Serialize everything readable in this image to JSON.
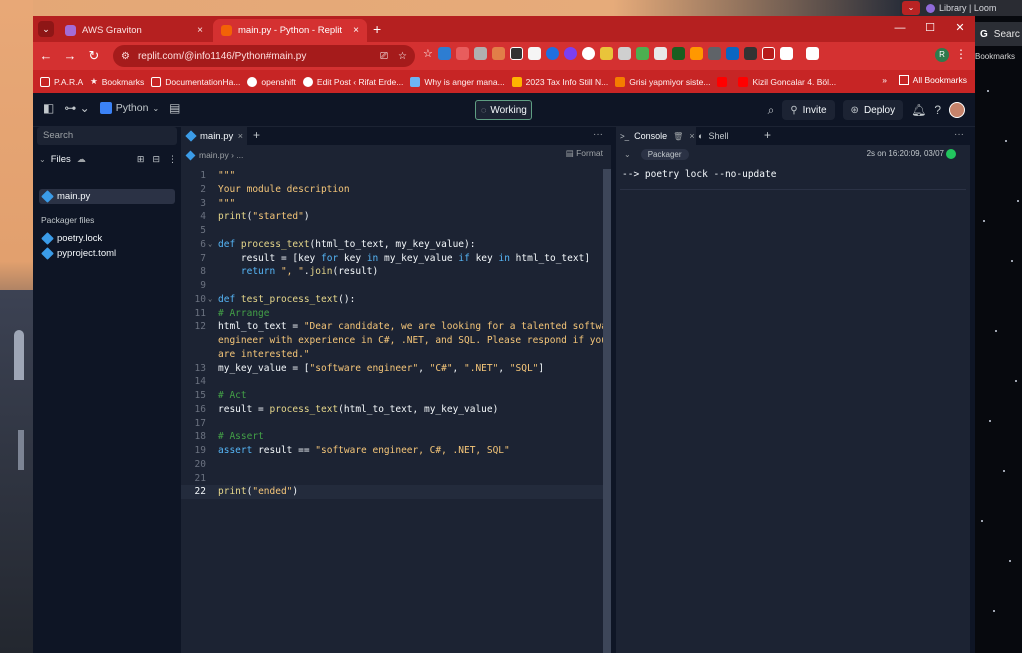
{
  "desktop": {
    "loom_tab_title": "Library | Loom",
    "peek_search": "Searc",
    "peek_bookmarks": "Bookmarks"
  },
  "browser": {
    "tabs": [
      {
        "title": "AWS Graviton",
        "close": "×"
      },
      {
        "title": "main.py - Python - Replit",
        "close": "×"
      }
    ],
    "new_tab": "+",
    "window_controls": {
      "minimize": "—",
      "maximize": "☐",
      "close": "✕"
    },
    "url": "replit.com/@info1146/Python#main.py",
    "bookmarks": [
      "P.A.R.A",
      "Bookmarks",
      "DocumentationHa...",
      "openshift",
      "Edit Post ‹ Rifat Erde...",
      "Why is anger mana...",
      "2023 Tax Info Still N...",
      "Grisi yapmiyor siste...",
      "",
      "Kizil Goncalar 4. Böl..."
    ],
    "bookmarks_more": "»",
    "all_bookmarks": "All Bookmarks",
    "profile_initial": "R"
  },
  "header": {
    "language": "Python",
    "status": "Working",
    "invite": "Invite",
    "deploy": "Deploy",
    "help": "?"
  },
  "sidebar": {
    "search_placeholder": "Search",
    "files_label": "Files",
    "files": [
      "main.py"
    ],
    "packager_label": "Packager files",
    "packager_files": [
      "poetry.lock",
      "pyproject.toml"
    ]
  },
  "editor": {
    "tab": "main.py",
    "breadcrumb": "main.py  ›  ...",
    "format": "Format",
    "lines": [
      {
        "n": "1",
        "t": "\"\"\"",
        "c": "str"
      },
      {
        "n": "2",
        "t": "Your module description",
        "c": "str"
      },
      {
        "n": "3",
        "t": "\"\"\"",
        "c": "str"
      },
      {
        "n": "4",
        "t": "print(\"started\")",
        "c": "mix"
      },
      {
        "n": "5",
        "t": "",
        "c": "tx"
      },
      {
        "n": "6",
        "t": "def process_text(html_to_text, my_key_value):",
        "c": "mix"
      },
      {
        "n": "7",
        "t": "    result = [key for key in my_key_value if key in html_to_text]",
        "c": "mix"
      },
      {
        "n": "8",
        "t": "    return \", \".join(result)",
        "c": "mix"
      },
      {
        "n": "9",
        "t": "",
        "c": "tx"
      },
      {
        "n": "10",
        "t": "def test_process_text():",
        "c": "mix"
      },
      {
        "n": "11",
        "t": "# Arrange",
        "c": "com"
      },
      {
        "n": "12",
        "t": "html_to_text = \"Dear candidate, we are looking for a talented software",
        "c": "mix"
      },
      {
        "n": "",
        "t": "engineer with experience in C#, .NET, and SQL. Please respond if you",
        "c": "str"
      },
      {
        "n": "",
        "t": "are interested.\"",
        "c": "str"
      },
      {
        "n": "13",
        "t": "my_key_value = [\"software engineer\", \"C#\", \".NET\", \"SQL\"]",
        "c": "mix"
      },
      {
        "n": "14",
        "t": "",
        "c": "tx"
      },
      {
        "n": "15",
        "t": "# Act",
        "c": "com"
      },
      {
        "n": "16",
        "t": "result = process_text(html_to_text, my_key_value)",
        "c": "mix"
      },
      {
        "n": "17",
        "t": "",
        "c": "tx"
      },
      {
        "n": "18",
        "t": "# Assert",
        "c": "com"
      },
      {
        "n": "19",
        "t": "assert result == \"software engineer, C#, .NET, SQL\"",
        "c": "mix"
      },
      {
        "n": "20",
        "t": "",
        "c": "tx"
      },
      {
        "n": "21",
        "t": "",
        "c": "tx"
      },
      {
        "n": "22",
        "t": "print(\"ended\")",
        "c": "mix"
      }
    ]
  },
  "console": {
    "tab": "Console",
    "shell_tab": "Shell",
    "packager_badge": "Packager",
    "timestamp": "2s on 16:20:09, 03/07",
    "output": "--> poetry lock --no-update"
  }
}
